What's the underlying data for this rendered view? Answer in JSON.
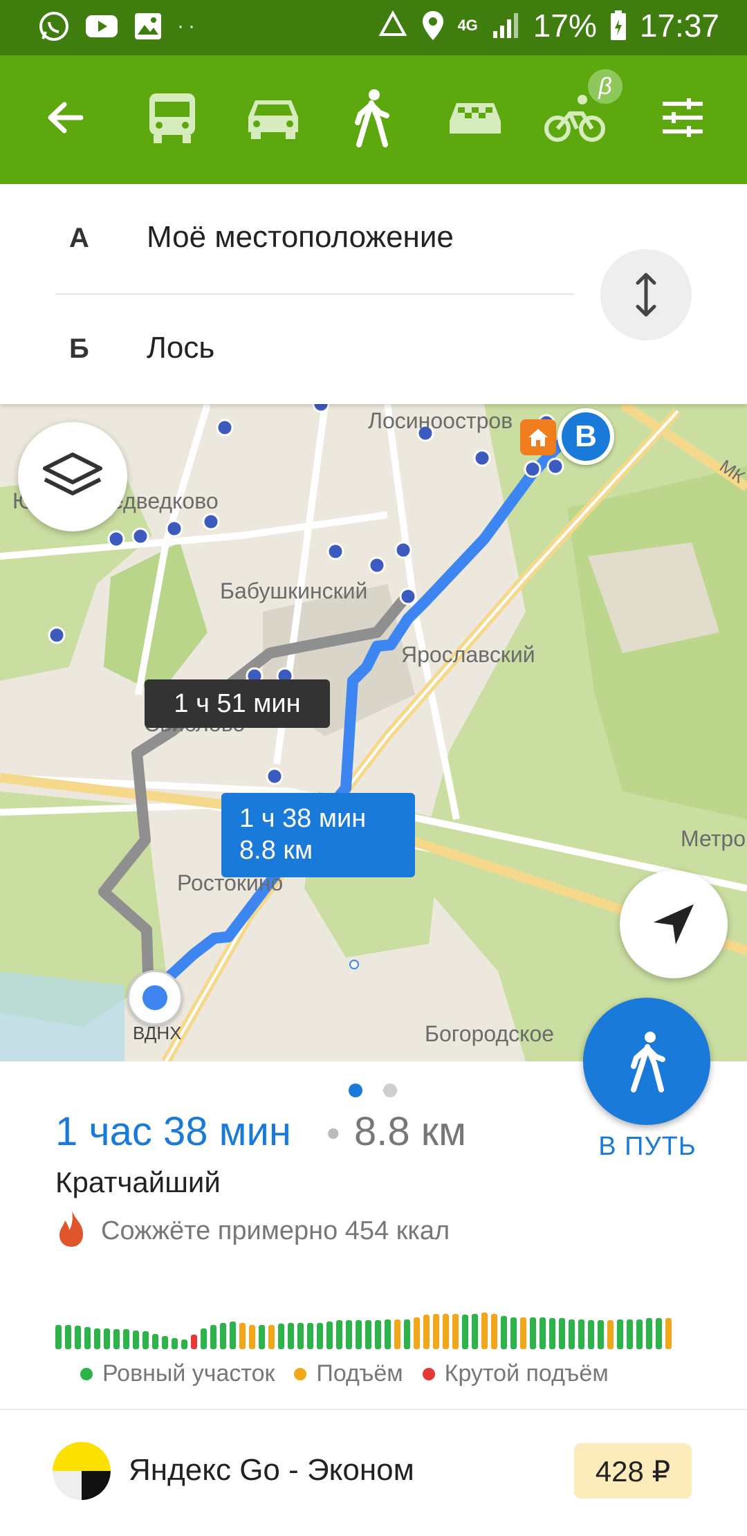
{
  "status_bar": {
    "network": "4G",
    "battery": "17%",
    "time": "17:37",
    "icons_left": [
      "whatsapp-icon",
      "youtube-icon",
      "gallery-icon",
      "more-dots-icon"
    ],
    "icons_right": [
      "recycle-icon",
      "location-pin-icon",
      "4g-icon",
      "signal-icon",
      "battery-icon"
    ]
  },
  "toolbar": {
    "modes": [
      "back-arrow-icon",
      "bus-icon",
      "car-icon",
      "walk-icon",
      "taxi-icon",
      "bicycle-icon",
      "filter-settings-icon"
    ],
    "beta_badge": "β",
    "active_mode": "walk"
  },
  "route_inputs": {
    "from_letter": "А",
    "from_value": "Моё местоположение",
    "to_letter": "Б",
    "to_value": "Лось"
  },
  "map": {
    "labels": {
      "losinoostrov": "Лосиноостров",
      "medvedkovo": "Южное Медведково",
      "babushkinsky": "Бабушкинский",
      "yaroslavsky": "Ярославский",
      "sviblovo": "Свиблово",
      "rostokino": "Ростокино",
      "vdnh": "ВДНХ",
      "bogorodskoe": "Богородское",
      "metro": "Метро",
      "mkad": "МК"
    },
    "alt_route_time": "1 ч 51 мин",
    "main_route_time": "1 ч 38 мин",
    "main_route_distance": "8.8 км",
    "destination_marker": "B"
  },
  "summary": {
    "time": "1 час 38 мин",
    "separator": "•",
    "distance": "8.8 км",
    "kind": "Кратчайший",
    "calories": "Сожжёте примерно 454 ккал",
    "go_label": "В ПУТЬ",
    "page_dots": 2,
    "active_page": 1
  },
  "elevation": {
    "colors": {
      "flat": "#2db34a",
      "climb": "#f0a81a",
      "steep": "#e53935"
    },
    "legend": {
      "flat": "Ровный участок",
      "climb": "Подъём",
      "steep": "Крутой подъём"
    },
    "bars": [
      {
        "h": 0.44,
        "t": "flat"
      },
      {
        "h": 0.44,
        "t": "flat"
      },
      {
        "h": 0.42,
        "t": "flat"
      },
      {
        "h": 0.4,
        "t": "flat"
      },
      {
        "h": 0.38,
        "t": "flat"
      },
      {
        "h": 0.38,
        "t": "flat"
      },
      {
        "h": 0.36,
        "t": "flat"
      },
      {
        "h": 0.36,
        "t": "flat"
      },
      {
        "h": 0.34,
        "t": "flat"
      },
      {
        "h": 0.32,
        "t": "flat"
      },
      {
        "h": 0.28,
        "t": "flat"
      },
      {
        "h": 0.24,
        "t": "flat"
      },
      {
        "h": 0.2,
        "t": "flat"
      },
      {
        "h": 0.18,
        "t": "flat"
      },
      {
        "h": 0.26,
        "t": "steep"
      },
      {
        "h": 0.38,
        "t": "flat"
      },
      {
        "h": 0.44,
        "t": "flat"
      },
      {
        "h": 0.48,
        "t": "flat"
      },
      {
        "h": 0.5,
        "t": "flat"
      },
      {
        "h": 0.48,
        "t": "climb"
      },
      {
        "h": 0.44,
        "t": "climb"
      },
      {
        "h": 0.44,
        "t": "flat"
      },
      {
        "h": 0.44,
        "t": "climb"
      },
      {
        "h": 0.46,
        "t": "flat"
      },
      {
        "h": 0.48,
        "t": "flat"
      },
      {
        "h": 0.48,
        "t": "flat"
      },
      {
        "h": 0.48,
        "t": "flat"
      },
      {
        "h": 0.48,
        "t": "flat"
      },
      {
        "h": 0.5,
        "t": "flat"
      },
      {
        "h": 0.52,
        "t": "flat"
      },
      {
        "h": 0.52,
        "t": "flat"
      },
      {
        "h": 0.52,
        "t": "flat"
      },
      {
        "h": 0.52,
        "t": "flat"
      },
      {
        "h": 0.52,
        "t": "flat"
      },
      {
        "h": 0.54,
        "t": "flat"
      },
      {
        "h": 0.54,
        "t": "climb"
      },
      {
        "h": 0.54,
        "t": "flat"
      },
      {
        "h": 0.58,
        "t": "climb"
      },
      {
        "h": 0.62,
        "t": "climb"
      },
      {
        "h": 0.64,
        "t": "climb"
      },
      {
        "h": 0.64,
        "t": "climb"
      },
      {
        "h": 0.64,
        "t": "climb"
      },
      {
        "h": 0.62,
        "t": "flat"
      },
      {
        "h": 0.64,
        "t": "flat"
      },
      {
        "h": 0.66,
        "t": "climb"
      },
      {
        "h": 0.64,
        "t": "climb"
      },
      {
        "h": 0.6,
        "t": "flat"
      },
      {
        "h": 0.58,
        "t": "flat"
      },
      {
        "h": 0.58,
        "t": "climb"
      },
      {
        "h": 0.58,
        "t": "flat"
      },
      {
        "h": 0.58,
        "t": "flat"
      },
      {
        "h": 0.56,
        "t": "flat"
      },
      {
        "h": 0.56,
        "t": "flat"
      },
      {
        "h": 0.54,
        "t": "flat"
      },
      {
        "h": 0.54,
        "t": "flat"
      },
      {
        "h": 0.52,
        "t": "flat"
      },
      {
        "h": 0.52,
        "t": "flat"
      },
      {
        "h": 0.52,
        "t": "climb"
      },
      {
        "h": 0.54,
        "t": "flat"
      },
      {
        "h": 0.54,
        "t": "flat"
      },
      {
        "h": 0.54,
        "t": "flat"
      },
      {
        "h": 0.56,
        "t": "flat"
      },
      {
        "h": 0.56,
        "t": "flat"
      },
      {
        "h": 0.56,
        "t": "climb"
      }
    ]
  },
  "taxi": {
    "name": "Яндекс Go - Эконом",
    "price": "428 ₽"
  }
}
